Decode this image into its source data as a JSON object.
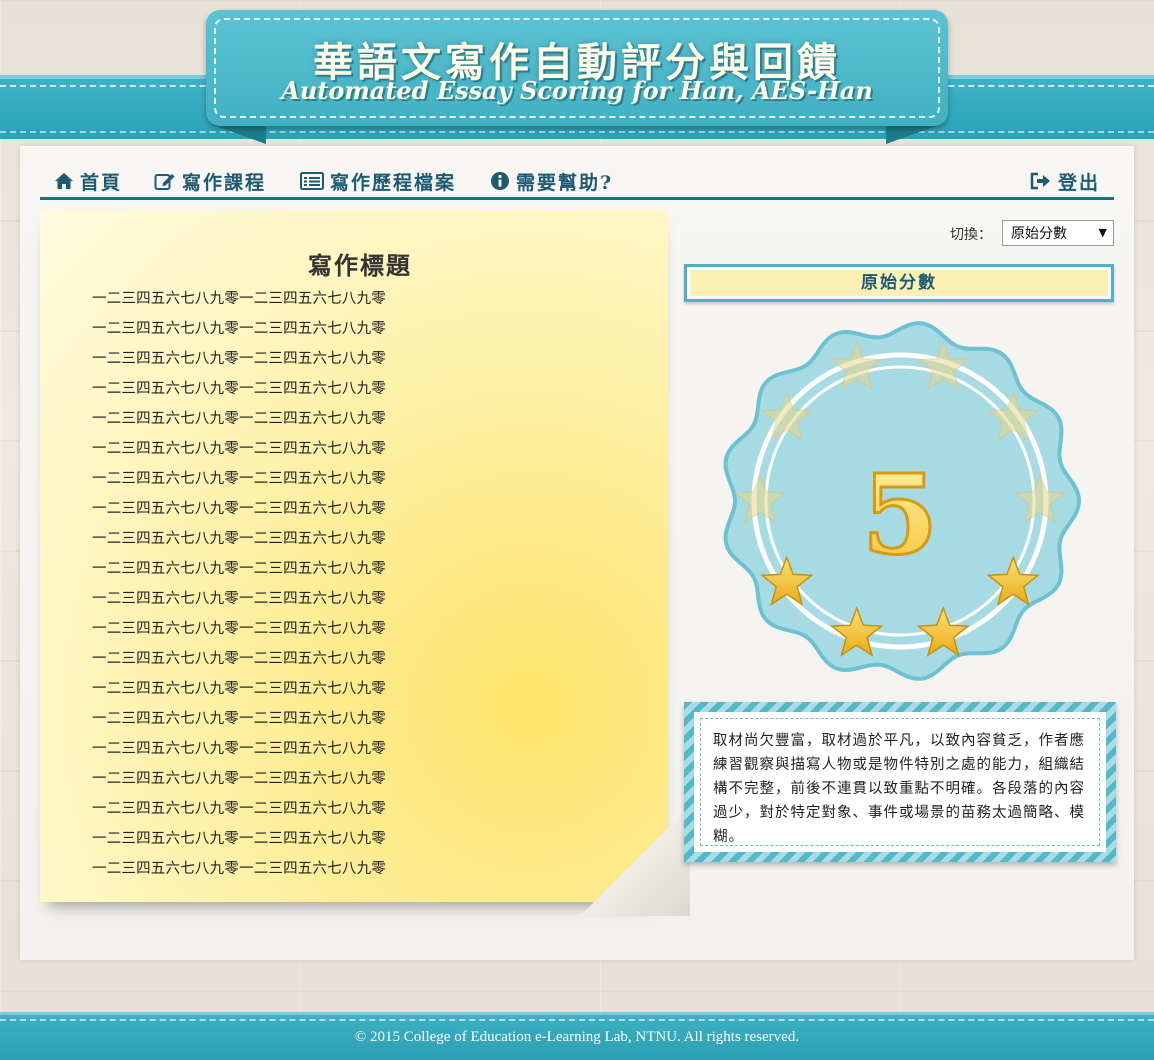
{
  "header": {
    "title": "華語文寫作自動評分與回饋",
    "subtitle": "Automated Essay Scoring for Han, AES-Han"
  },
  "nav": {
    "home": "首頁",
    "writing_course": "寫作課程",
    "portfolio": "寫作歷程檔案",
    "help": "需要幫助?",
    "logout": "登出"
  },
  "switch": {
    "label": "切換：",
    "selected": "原始分數"
  },
  "essay": {
    "title": "寫作標題",
    "lines": [
      "一二三四五六七八九零一二三四五六七八九零",
      "一二三四五六七八九零一二三四五六七八九零",
      "一二三四五六七八九零一二三四五六七八九零",
      "一二三四五六七八九零一二三四五六七八九零",
      "一二三四五六七八九零一二三四五六七八九零",
      "一二三四五六七八九零一二三四五六七八九零",
      "一二三四五六七八九零一二三四五六七八九零",
      "一二三四五六七八九零一二三四五六七八九零",
      "一二三四五六七八九零一二三四五六七八九零",
      "一二三四五六七八九零一二三四五六七八九零",
      "一二三四五六七八九零一二三四五六七八九零",
      "一二三四五六七八九零一二三四五六七八九零",
      "一二三四五六七八九零一二三四五六七八九零",
      "一二三四五六七八九零一二三四五六七八九零",
      "一二三四五六七八九零一二三四五六七八九零",
      "一二三四五六七八九零一二三四五六七八九零",
      "一二三四五六七八九零一二三四五六七八九零",
      "一二三四五六七八九零一二三四五六七八九零",
      "一二三四五六七八九零一二三四五六七八九零",
      "一二三四五六七八九零一二三四五六七八九零"
    ]
  },
  "score": {
    "heading": "原始分數",
    "value": "5",
    "stars_total": 10,
    "stars_filled": 5,
    "feedback": "取材尚欠豐富，取材過於平凡，以致內容貧乏，作者應練習觀察與描寫人物或是物件特別之處的能力，組織結構不完整，前後不連貫以致重點不明確。各段落的內容過少，對於特定對象、事件或場景的苗務太過簡略、模糊。"
  },
  "footer": {
    "text": "© 2015 College of Education e-Learning Lab, NTNU. All rights reserved."
  },
  "colors": {
    "accent": "#40b0c3",
    "nav_text": "#1e5b73",
    "note_yellow": "#fde46a",
    "badge_bg": "#a7dbe4",
    "star_gold": "#f2c230"
  }
}
